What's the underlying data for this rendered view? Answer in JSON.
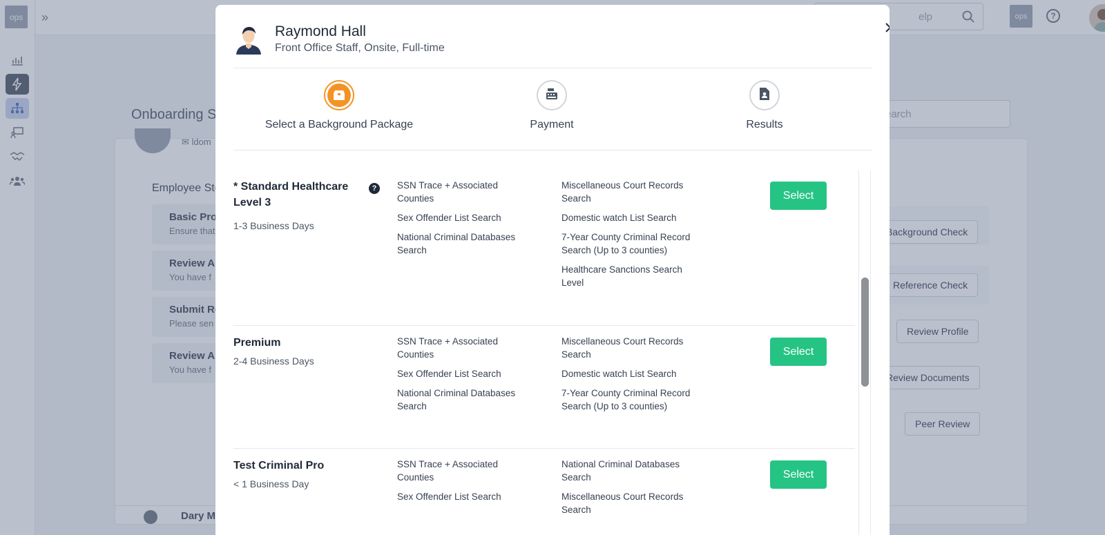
{
  "app": {
    "logo_text": "ops",
    "top_search_placeholder": "elp",
    "top_ops_text": "ops",
    "top_help_text": "?"
  },
  "background": {
    "page_title": "Onboarding S",
    "page_search_placeholder": "earch",
    "email_text": "ldom",
    "steps_title": "Employee Ste",
    "steps": [
      {
        "title": "Basic Prof",
        "subtitle": "Ensure that"
      },
      {
        "title": "Review Ar",
        "subtitle": "You have f"
      },
      {
        "title": "Submit Re",
        "subtitle": "Please sen"
      },
      {
        "title": "Review Ar",
        "subtitle": "You have f"
      }
    ],
    "actions": [
      "Background Check",
      "Reference Check",
      "Review Profile",
      "Review Documents",
      "Peer Review"
    ],
    "bottom_name": "Dary M"
  },
  "modal": {
    "name": "Raymond Hall",
    "role": "Front Office Staff, Onsite, Full-time",
    "steps": [
      {
        "label": "Select a Background Package",
        "icon": "box-icon",
        "active": true
      },
      {
        "label": "Payment",
        "icon": "cash-register-icon",
        "active": false
      },
      {
        "label": "Results",
        "icon": "file-user-icon",
        "active": false
      }
    ],
    "select_label": "Select",
    "packages": [
      {
        "name": "* Standard Healthcare Level 3",
        "days": "1-3 Business Days",
        "col1": [
          "SSN Trace + Associated Counties",
          "Sex Offender List Search",
          "National Criminal Databases Search"
        ],
        "col2": [
          "Miscellaneous Court Records Search",
          "Domestic watch List Search",
          "7-Year County Criminal Record Search (Up to 3 counties)",
          "Healthcare Sanctions Search Level"
        ]
      },
      {
        "name": "Premium",
        "days": "2-4 Business Days",
        "col1": [
          "SSN Trace + Associated Counties",
          "Sex Offender List Search",
          "National Criminal Databases Search"
        ],
        "col2": [
          "Miscellaneous Court Records Search",
          "Domestic watch List Search",
          "7-Year County Criminal Record Search (Up to 3 counties)"
        ]
      },
      {
        "name": "Test Criminal Pro",
        "days": "< 1 Business Day",
        "col1": [
          "SSN Trace + Associated Counties",
          "Sex Offender List Search"
        ],
        "col2": [
          "National Criminal Databases Search",
          "Miscellaneous Court Records Search"
        ]
      }
    ]
  },
  "colors": {
    "accent": "#f49325",
    "select_button": "#26c484",
    "overlay": "#5a6885"
  }
}
